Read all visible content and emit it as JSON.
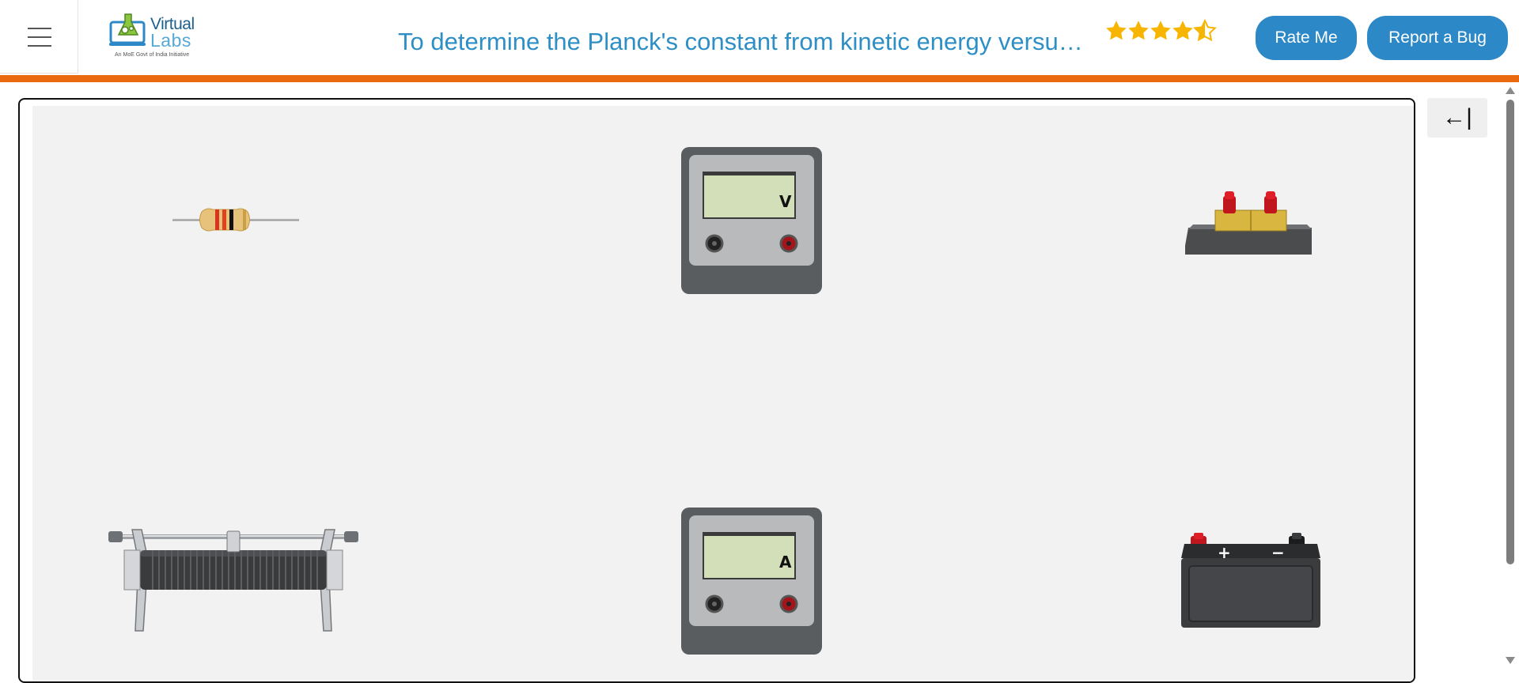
{
  "header": {
    "logo": {
      "line1": "Virtual",
      "line2": "Labs",
      "tagline": "An MoE Govt of India Initiative"
    },
    "title": "To determine the Planck's constant from kinetic energy versus frequency graph",
    "rating": 4.5,
    "rate_label": "Rate Me",
    "bug_label": "Report a Bug"
  },
  "workbench": {
    "components": [
      {
        "id": "resistor"
      },
      {
        "id": "voltmeter",
        "display": "V"
      },
      {
        "id": "key"
      },
      {
        "id": "rheostat"
      },
      {
        "id": "ammeter",
        "display": "A"
      },
      {
        "id": "battery",
        "positive": "+",
        "negative": "−"
      }
    ]
  },
  "panel_toggle": {
    "icon": "arrow-left-to-bar-icon",
    "glyph": "←|"
  },
  "colors": {
    "accent": "#2c88c6",
    "orange": "#ea6a0f",
    "title": "#2e8fc6",
    "star": "#f7b500"
  }
}
